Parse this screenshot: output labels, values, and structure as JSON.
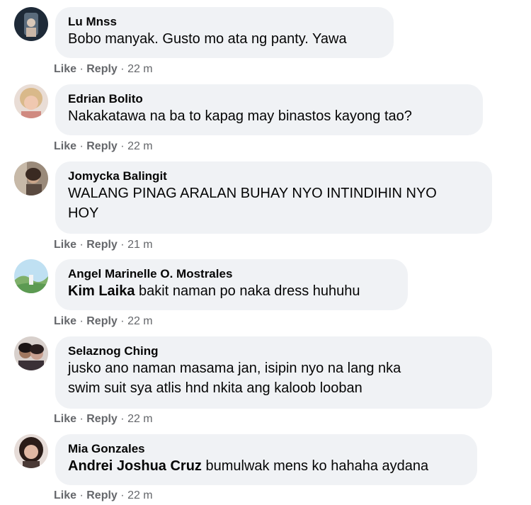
{
  "comments": [
    {
      "author": "Lu Mnss",
      "mention": "",
      "text": "Bobo manyak. Gusto mo ata ng panty. Yawa",
      "text2": "",
      "like": "Like",
      "reply": "Reply",
      "time": "22 m"
    },
    {
      "author": "Edrian Bolito",
      "mention": "",
      "text": "Nakakatawa na ba to kapag may binastos kayong tao?",
      "text2": "",
      "like": "Like",
      "reply": "Reply",
      "time": "22 m"
    },
    {
      "author": "Jomycka Balingit",
      "mention": "",
      "text": "WALANG PINAG ARALAN BUHAY NYO INTINDIHIN NYO",
      "text2": "HOY",
      "like": "Like",
      "reply": "Reply",
      "time": "21 m"
    },
    {
      "author": "Angel Marinelle O. Mostrales",
      "mention": "Kim Laika",
      "text": "bakit naman po naka dress huhuhu",
      "text2": "",
      "like": "Like",
      "reply": "Reply",
      "time": "22 m"
    },
    {
      "author": "Selaznog Ching",
      "mention": "",
      "text": "jusko ano naman masama jan, isipin nyo na lang nka",
      "text2": "swim suit sya atlis hnd nkita ang kaloob looban",
      "like": "Like",
      "reply": "Reply",
      "time": "22 m"
    },
    {
      "author": "Mia Gonzales",
      "mention": "Andrei Joshua Cruz",
      "text": "bumulwak mens ko hahaha aydana",
      "text2": "",
      "like": "Like",
      "reply": "Reply",
      "time": "22 m"
    }
  ],
  "separator": "·"
}
